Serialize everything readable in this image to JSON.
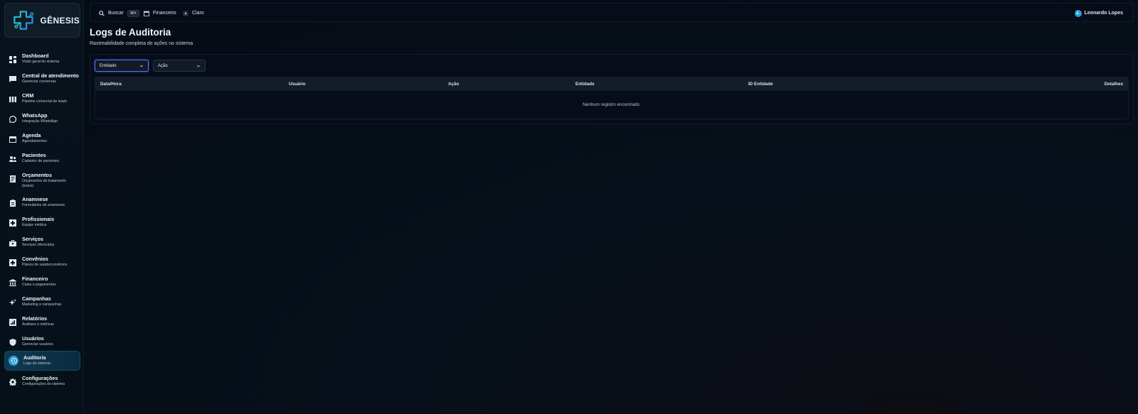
{
  "brand": {
    "name": "GÊNESIS"
  },
  "sidebar": {
    "items": [
      {
        "label": "Dashboard",
        "sub": "Visão geral do sistema",
        "icon": "dashboard-icon"
      },
      {
        "label": "Central de atendimento",
        "sub": "Gerenciar conversas",
        "icon": "chat-icon"
      },
      {
        "label": "CRM",
        "sub": "Pipeline comercial de leads",
        "icon": "pipeline-icon"
      },
      {
        "label": "WhatsApp",
        "sub": "Integração WhatsApp",
        "icon": "whatsapp-icon"
      },
      {
        "label": "Agenda",
        "sub": "Agendamentos",
        "icon": "calendar-icon"
      },
      {
        "label": "Pacientes",
        "sub": "Cadastro de pacientes",
        "icon": "people-icon"
      },
      {
        "label": "Orçamentos",
        "sub": "Orçamentos de tratamento (todos)",
        "icon": "receipt-icon"
      },
      {
        "label": "Anamnese",
        "sub": "Formulários de anamnese",
        "icon": "clipboard-icon"
      },
      {
        "label": "Profissionais",
        "sub": "Equipe médica",
        "icon": "medical-icon"
      },
      {
        "label": "Serviços",
        "sub": "Serviços oferecidos",
        "icon": "briefcase-icon"
      },
      {
        "label": "Convênios",
        "sub": "Planos de saúde/convênios",
        "icon": "health-plan-icon"
      },
      {
        "label": "Financeiro",
        "sub": "Caixa e pagamentos",
        "icon": "bank-icon"
      },
      {
        "label": "Campanhas",
        "sub": "Marketing e campanhas",
        "icon": "sparkle-icon"
      },
      {
        "label": "Relatórios",
        "sub": "Análises e métricas",
        "icon": "chart-icon"
      },
      {
        "label": "Usuários",
        "sub": "Gerenciar usuários",
        "icon": "shield-user-icon"
      },
      {
        "label": "Auditoria",
        "sub": "Logs do sistema",
        "icon": "history-icon",
        "active": true
      },
      {
        "label": "Configurações",
        "sub": "Configurações do sistema",
        "icon": "gear-icon"
      }
    ]
  },
  "topbar": {
    "search_label": "Buscar",
    "search_shortcut": "⌘K",
    "finance_label": "Financeiro",
    "theme_label": "Claro",
    "user_initial": "L",
    "user_name": "Leonardo Lopes"
  },
  "page": {
    "title": "Logs de Auditoria",
    "subtitle": "Rastreabilidade completa de ações no sistema"
  },
  "filters": {
    "entity_value": "Entidade",
    "action_value": "Ação"
  },
  "table": {
    "columns": [
      "Data/Hora",
      "Usuário",
      "Ação",
      "Entidade",
      "ID Entidade",
      "Detalhes"
    ],
    "empty_message": "Nenhum registro encontrado."
  },
  "colors": {
    "accent": "#2a9fd6",
    "focus": "#4b6cff",
    "background": "#050b14"
  }
}
